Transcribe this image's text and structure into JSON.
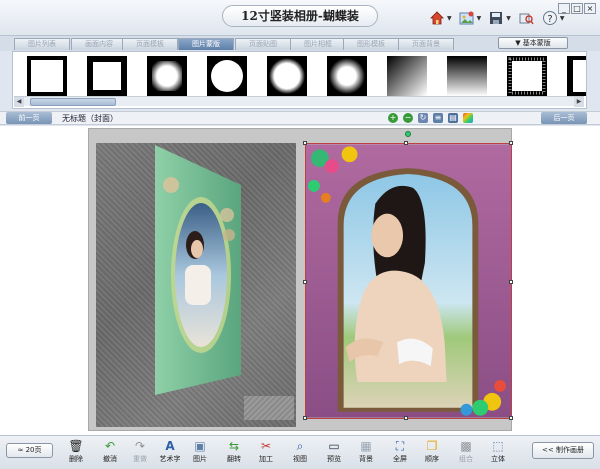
{
  "window": {
    "title": "12寸竖装相册-蝴蝶装",
    "controls": [
      "_",
      "□",
      "×"
    ]
  },
  "title_icons": {
    "home": "home-icon",
    "photo": "photo-icon",
    "save": "save-icon",
    "tools": "tools-icon",
    "help": "help-icon"
  },
  "tabs": [
    {
      "label": "图片列表",
      "active": false
    },
    {
      "label": "画面内容",
      "active": false
    },
    {
      "label": "页面模板",
      "active": false
    },
    {
      "label": "图片蒙版",
      "active": true
    },
    {
      "label": "页面贴图",
      "active": false
    },
    {
      "label": "图片相框",
      "active": false
    },
    {
      "label": "图形模板",
      "active": false
    },
    {
      "label": "页面背景",
      "active": false
    }
  ],
  "basic_mask_button": "基本蒙版",
  "nav": {
    "prev": "前一页",
    "next": "后一页",
    "page_name": "无标题（封面）"
  },
  "bottom": {
    "pages_button": "≈ 20页",
    "make_button": "<< 制作画册",
    "tools": [
      {
        "label": "删除",
        "icon": "trash-icon",
        "enabled": true
      },
      {
        "label": "撤消",
        "icon": "undo-icon",
        "enabled": true
      },
      {
        "label": "重做",
        "icon": "redo-icon",
        "enabled": false
      },
      {
        "label": "艺术字",
        "icon": "art-text-icon",
        "enabled": true
      },
      {
        "label": "图片",
        "icon": "image-icon",
        "enabled": true
      },
      {
        "label": "翻转",
        "icon": "flip-icon",
        "enabled": true
      },
      {
        "label": "加工",
        "icon": "scissors-icon",
        "enabled": true
      },
      {
        "label": "视图",
        "icon": "zoom-icon",
        "enabled": true
      },
      {
        "label": "预览",
        "icon": "monitor-icon",
        "enabled": true
      },
      {
        "label": "背景",
        "icon": "background-icon",
        "enabled": true
      },
      {
        "label": "全屏",
        "icon": "fullscreen-icon",
        "enabled": true
      },
      {
        "label": "顺序",
        "icon": "order-icon",
        "enabled": true
      },
      {
        "label": "组合",
        "icon": "group-icon",
        "enabled": false
      },
      {
        "label": "立体",
        "icon": "cube-icon",
        "enabled": true
      }
    ]
  }
}
